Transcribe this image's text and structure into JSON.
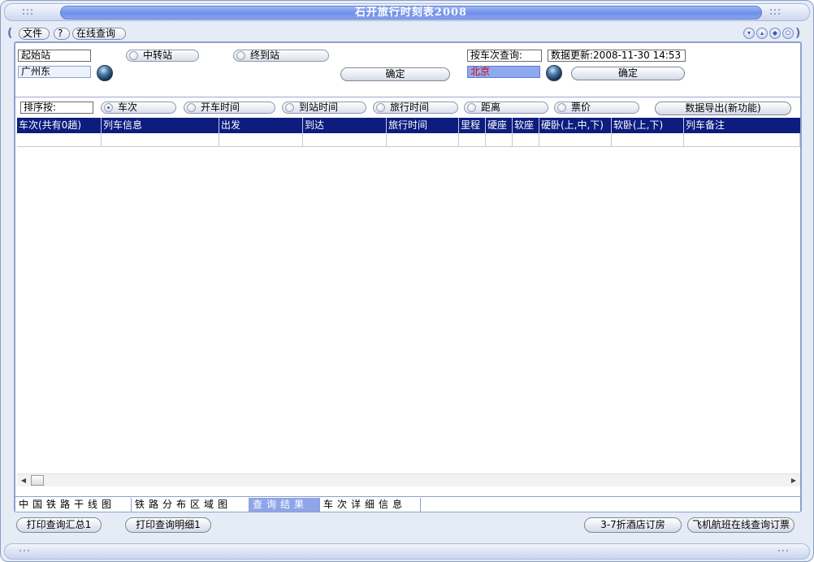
{
  "window": {
    "title": "石开旅行时刻表2008"
  },
  "menu": {
    "file": "文件",
    "help": "?",
    "online": "在线查询"
  },
  "station_query": {
    "start_label": "起始站",
    "start_value": "广州东",
    "transfer_label": "中转站",
    "end_label": "终到站",
    "confirm_label": "确定"
  },
  "train_query": {
    "label": "按车次查询:",
    "update_text": "数据更新:2008-11-30 14:53",
    "value": "北京",
    "confirm_label": "确定"
  },
  "sort": {
    "label": "排序按:",
    "options": [
      "车次",
      "开车时间",
      "到站时间",
      "旅行时间",
      "距离",
      "票价"
    ],
    "selected": "车次",
    "export_label": "数据导出(新功能)"
  },
  "table": {
    "columns": [
      "车次(共有0趟)",
      "列车信息",
      "出发",
      "到达",
      "旅行时间",
      "里程",
      "硬座",
      "软座",
      "硬卧(上,中,下)",
      "软卧(上,下)",
      "列车备注"
    ]
  },
  "tabs": {
    "items": [
      "中国铁路干线图",
      "铁路分布区域图",
      "查询结果",
      "车次详细信息"
    ],
    "active": "查询结果"
  },
  "toolbar": {
    "print_summary": "打印查询汇总1",
    "print_detail": "打印查询明细1",
    "hotel": "3-7折酒店订房",
    "flight": "飞机航班在线查询订票"
  },
  "colors": {
    "header_bg": "#0c1d7e",
    "title_pill": "#6e8fe8",
    "active_tab": "#8fa5e8",
    "query_value_text": "#e00000"
  }
}
